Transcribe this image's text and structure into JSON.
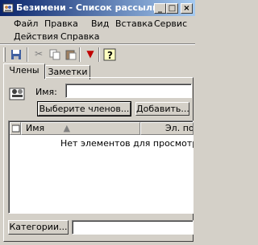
{
  "window": {
    "title": "Безимени - Список рассылки",
    "min": "_",
    "max": "□",
    "close": "×"
  },
  "menu": [
    "Файл",
    "Правка",
    "Вид",
    "Вставка",
    "Сервис",
    "Действия",
    "Справка"
  ],
  "tabs": [
    "Члены",
    "Заметки"
  ],
  "form": {
    "name_label": "Имя:",
    "name_value": "",
    "select_members_button": "Выберите членов...",
    "add_button": "Добавить..."
  },
  "list": {
    "columns": [
      "Имя",
      "Эл. почта"
    ],
    "empty_text": "Нет элементов для просмотра в данном"
  },
  "footer": {
    "categories_button": "Категории..."
  }
}
